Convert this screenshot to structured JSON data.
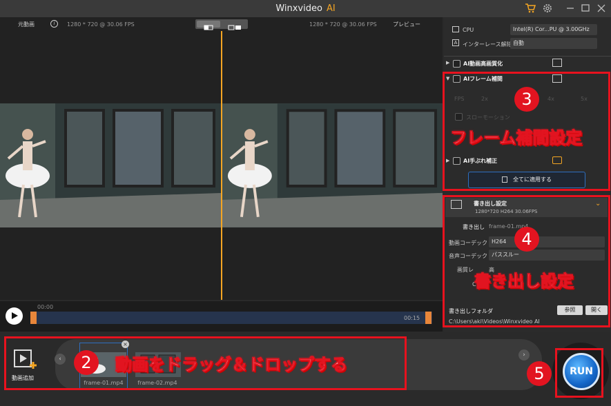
{
  "app": {
    "title": "Winxvideo",
    "title_ai": "AI"
  },
  "titlebar": {
    "cart_icon": "cart-icon",
    "gear_icon": "gear-icon"
  },
  "header": {
    "original_label": "元動画",
    "info_icon": "i",
    "original_info": "1280 * 720 @ 30.06 FPS",
    "preview_info": "1280 * 720 @ 30.06 FPS",
    "preview_label": "プレビュー"
  },
  "timeline": {
    "start_time": "00:00",
    "end_time": "00:15"
  },
  "settings": {
    "cpu_label": "CPU",
    "cpu_value": "Intel(R) Cor...PU @ 3.00GHz",
    "deinterlace_label": "インターレース解除",
    "deinterlace_value": "自動",
    "ai_upscale_label": "AI動画高画質化",
    "ai_frame_label": "AIフレーム補間",
    "fps_label": "FPS",
    "fps_options": [
      "2x",
      "3x",
      "4x",
      "5x"
    ],
    "slowmo_label": "スローモーション",
    "ai_stabilize_label": "AI手ぶれ補正",
    "apply_all_label": "全てに適用する"
  },
  "export": {
    "title": "書き出し設定",
    "info": "1280*720   H264   30.06FPS",
    "output_label": "書き出し",
    "output_value": "frame-01.mp4",
    "video_codec_label": "動画コーデック",
    "video_codec_value": "H264",
    "audio_codec_label": "音声コーデック",
    "audio_codec_value": "パススルー",
    "quality_label": "画質レ",
    "quality_value": "高",
    "other_label": "C",
    "folder_label": "書き出しフォルダ",
    "browse_label": "参照",
    "open_label": "開く",
    "folder_path": "C:\\Users\\aki\\Videos\\Winxvideo AI"
  },
  "bottom": {
    "add_video_label": "動画追加",
    "files": [
      "frame-01.mp4",
      "frame-02.mp4"
    ],
    "run_label": "RUN"
  },
  "annotations": {
    "step2_number": "2",
    "step2_text": "動画をドラッグ＆ドロップする",
    "step3_number": "3",
    "step3_text": "フレーム補間設定",
    "step4_number": "4",
    "step4_text": "書き出し設定",
    "step5_number": "5"
  },
  "colors": {
    "accent": "#f5a623",
    "annotation_red": "#e21420",
    "run_blue": "#1466c8"
  }
}
